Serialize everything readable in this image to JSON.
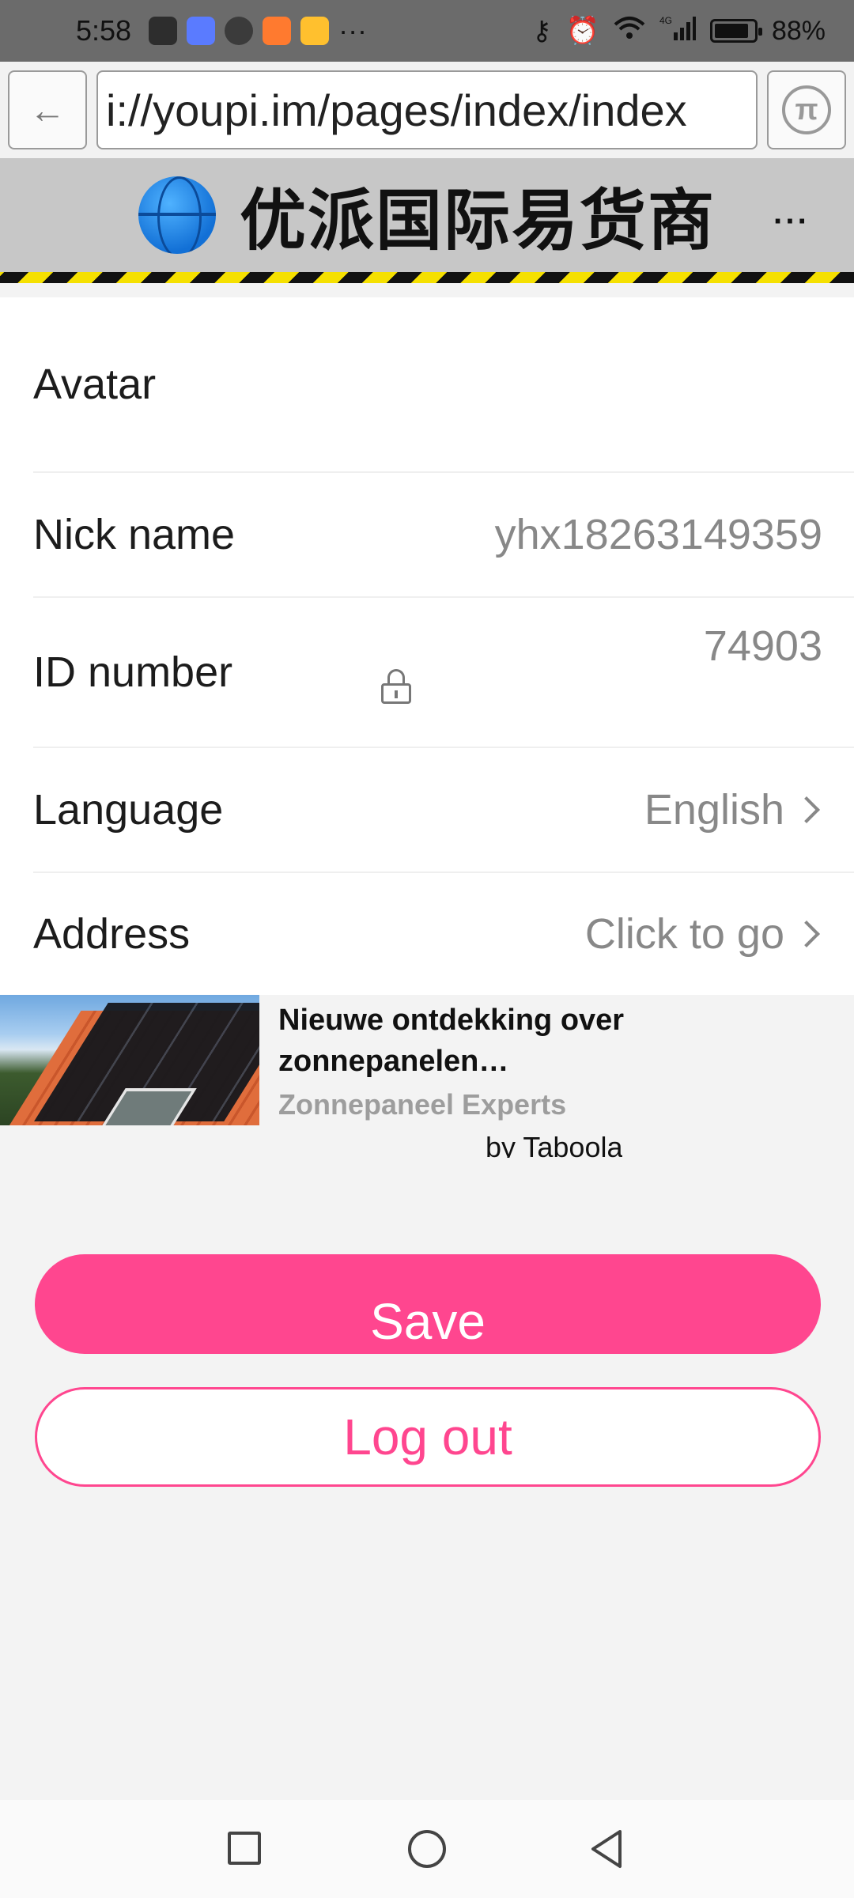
{
  "status_bar": {
    "time": "5:58",
    "overflow": "···",
    "network": "4G",
    "battery_percent": "88%",
    "battery_level": 0.88
  },
  "browser": {
    "url": "i://youpi.im/pages/index/index",
    "back_icon": "arrow-left-icon",
    "pi_icon": "pi-icon",
    "pi_symbol": "π"
  },
  "header": {
    "title": "优派国际易货商",
    "more_label": "···"
  },
  "form": {
    "avatar_label": "Avatar",
    "nickname_label": "Nick name",
    "nickname_value": "yhx18263149359",
    "id_label": "ID number",
    "id_value": "74903",
    "language_label": "Language",
    "language_value": "English",
    "address_label": "Address",
    "address_value": "Click to go"
  },
  "ad": {
    "title": "Nieuwe ontdekking over zonnepanelen…",
    "source": "Zonnepaneel Experts",
    "by": "by Taboola"
  },
  "buttons": {
    "save": "Save",
    "logout": "Log out"
  },
  "colors": {
    "accent": "#ff468f",
    "header_bg": "#c7c7c7"
  }
}
